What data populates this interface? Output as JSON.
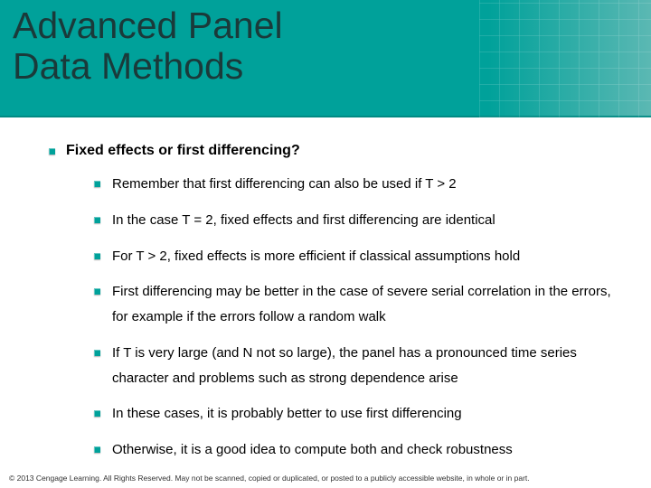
{
  "title_line1": "Advanced Panel",
  "title_line2": "Data Methods",
  "heading": "Fixed effects or first differencing?",
  "items": [
    "Remember that first differencing can also be used if T > 2",
    "In the case T = 2, fixed effects and first differencing are identical",
    "For T > 2, fixed effects is more efficient if classical assumptions hold",
    "First differencing may be better in the case of severe serial correlation in the errors, for example if the errors follow a random walk",
    "If T is very large (and N not so large), the panel has a pronounced time series character and problems such as strong dependence arise",
    "In these cases, it is probably better to use first differencing",
    "Otherwise, it is a good idea to compute both and check robustness"
  ],
  "footer": "© 2013 Cengage Learning. All Rights Reserved. May not be scanned, copied or duplicated, or posted to a publicly accessible website, in whole or in part."
}
